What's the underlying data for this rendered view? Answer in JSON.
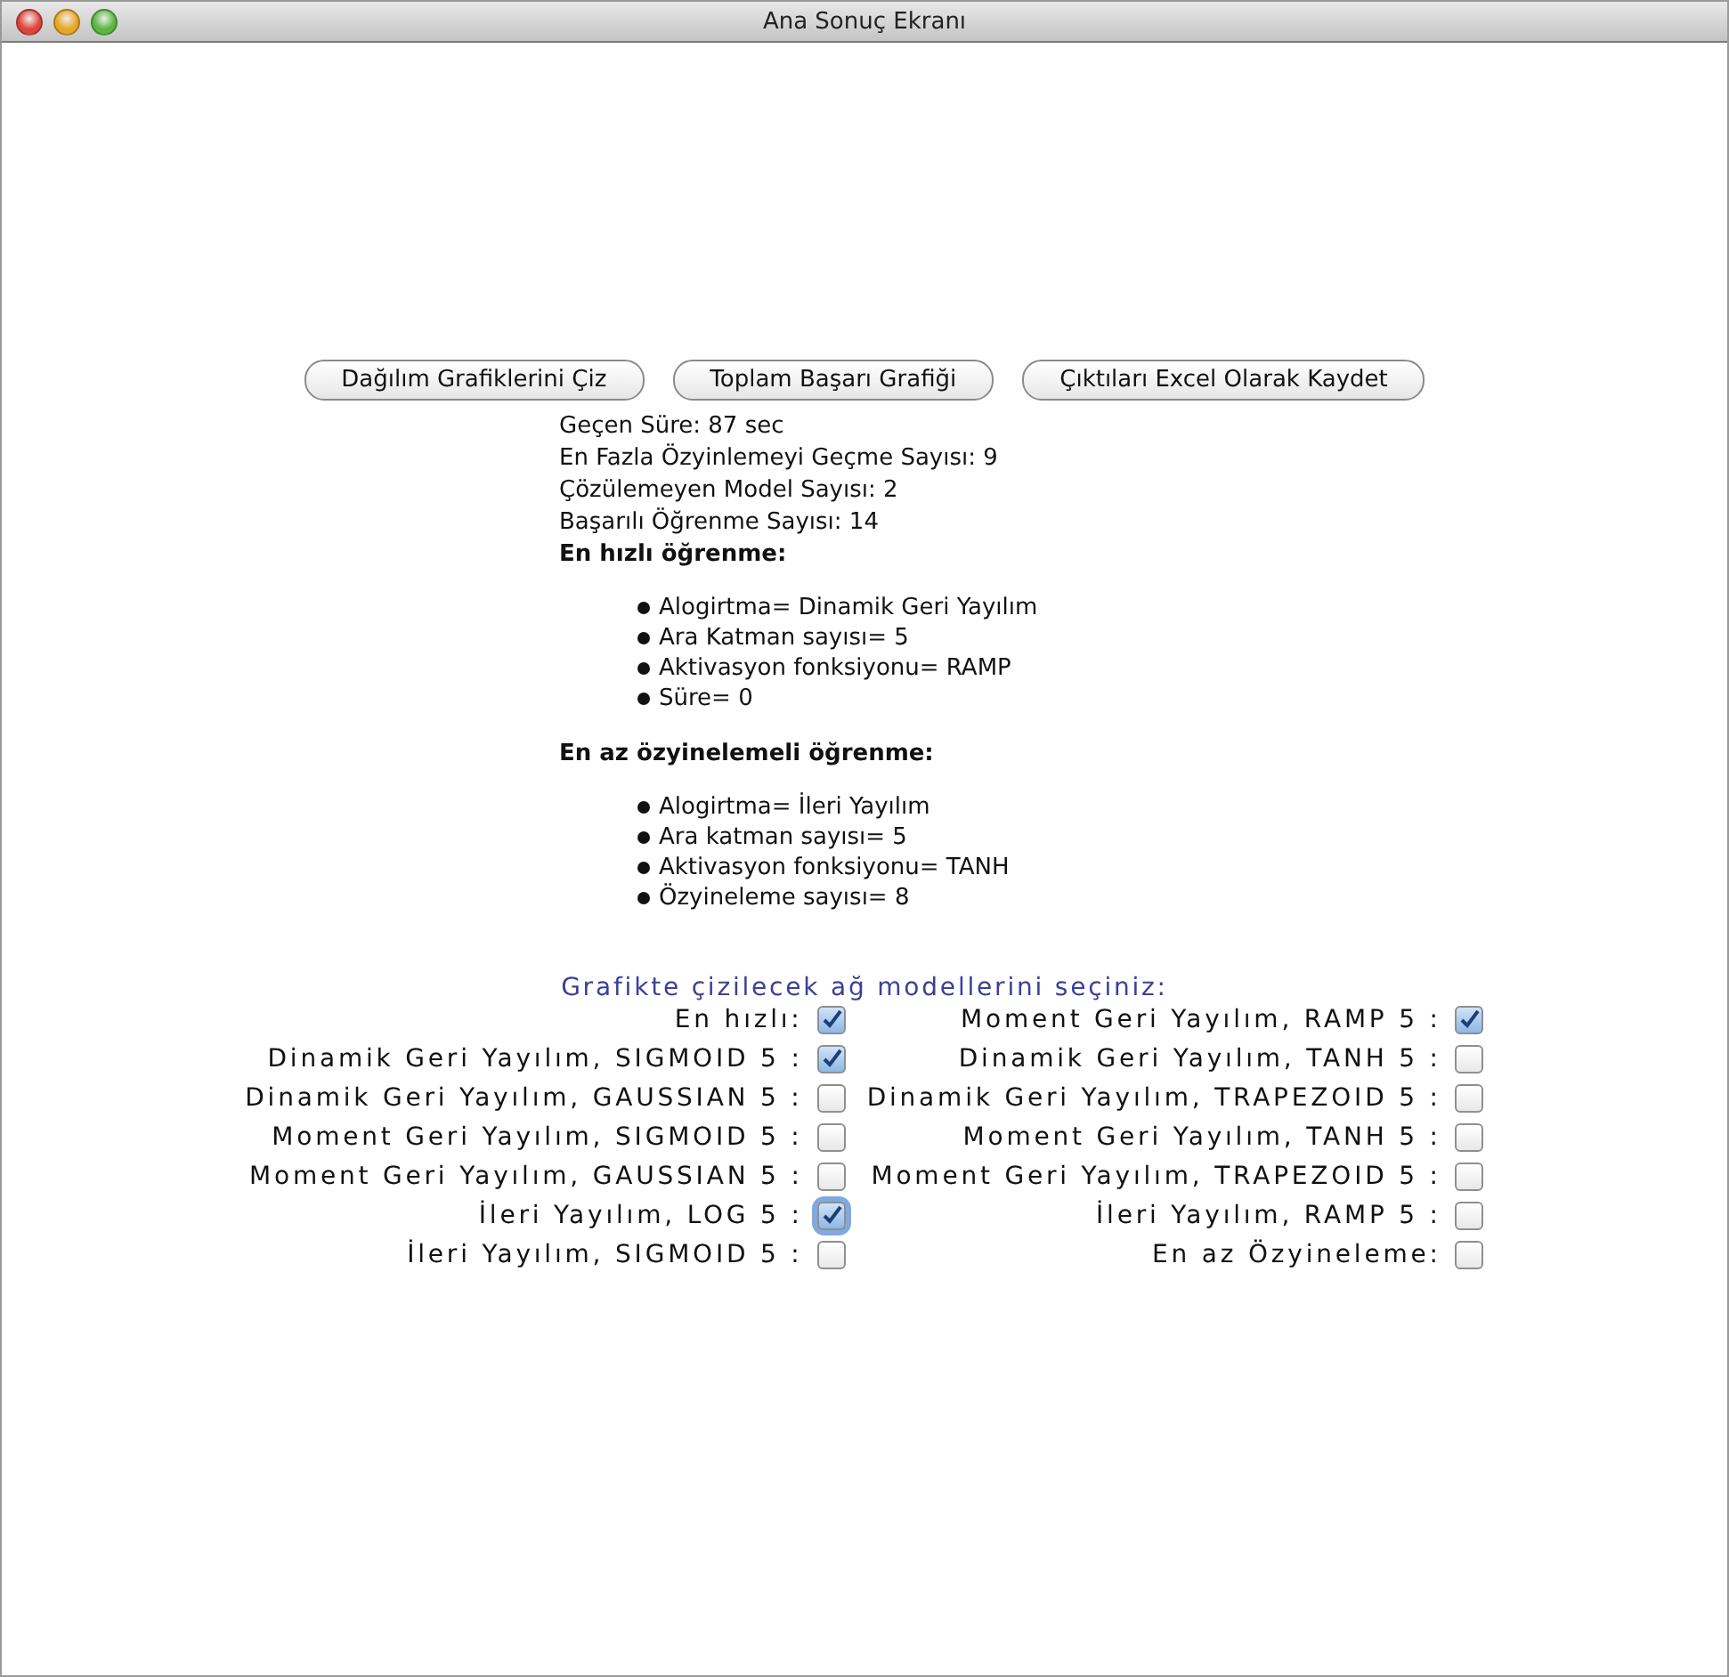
{
  "window": {
    "title": "Ana Sonuç Ekranı"
  },
  "buttons": [
    "Dağılım Grafiklerini Çiz",
    "Toplam Başarı Grafiği",
    "Çıktıları Excel Olarak Kaydet"
  ],
  "stats": [
    "Geçen Süre: 87 sec",
    "En Fazla Özyinlemeyi Geçme Sayısı: 9",
    "Çözülemeyen Model Sayısı: 2",
    "Başarılı Öğrenme Sayısı: 14"
  ],
  "sections": [
    {
      "heading": "En hızlı öğrenme:",
      "items": [
        "Alogirtma= Dinamik Geri Yayılım",
        "Ara Katman sayısı= 5",
        "Aktivasyon fonksiyonu= RAMP",
        "Süre= 0"
      ]
    },
    {
      "heading": "En az özyinelemeli öğrenme:",
      "items": [
        "Alogirtma= İleri Yayılım",
        "Ara katman sayısı= 5",
        "Aktivasyon fonksiyonu= TANH",
        "Özyineleme sayısı= 8"
      ]
    }
  ],
  "model_selection": {
    "title": "Grafikte çizilecek ağ modellerini seçiniz:",
    "options": [
      {
        "label": "En hızlı:",
        "checked": true,
        "focused": false
      },
      {
        "label": "Moment Geri Yayılım, RAMP 5 :",
        "checked": true,
        "focused": false
      },
      {
        "label": "Dinamik Geri Yayılım, SIGMOID 5 :",
        "checked": true,
        "focused": false
      },
      {
        "label": "Dinamik Geri Yayılım, TANH 5 :",
        "checked": false,
        "focused": false
      },
      {
        "label": "Dinamik Geri Yayılım, GAUSSIAN 5 :",
        "checked": false,
        "focused": false
      },
      {
        "label": "Dinamik Geri Yayılım, TRAPEZOID 5 :",
        "checked": false,
        "focused": false
      },
      {
        "label": "Moment Geri Yayılım, SIGMOID 5 :",
        "checked": false,
        "focused": false
      },
      {
        "label": "Moment Geri Yayılım, TANH 5 :",
        "checked": false,
        "focused": false
      },
      {
        "label": "Moment Geri Yayılım, GAUSSIAN 5 :",
        "checked": false,
        "focused": false
      },
      {
        "label": "Moment Geri Yayılım, TRAPEZOID 5 :",
        "checked": false,
        "focused": false
      },
      {
        "label": "İleri Yayılım, LOG 5 :",
        "checked": true,
        "focused": true
      },
      {
        "label": "İleri Yayılım, RAMP 5 :",
        "checked": false,
        "focused": false
      },
      {
        "label": "İleri Yayılım, SIGMOID 5 :",
        "checked": false,
        "focused": false
      },
      {
        "label": "En az Özyineleme:",
        "checked": false,
        "focused": false
      }
    ]
  }
}
